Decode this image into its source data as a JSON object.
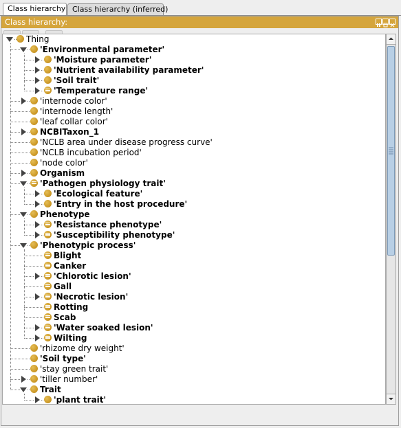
{
  "tabs": [
    {
      "label": "Class hierarchy",
      "active": true
    },
    {
      "label": "Class hierarchy (inferred)",
      "active": false
    }
  ],
  "panel": {
    "title": "Class hierarchy:",
    "header_color": "#d5a53c",
    "header_buttons": [
      "restore-icon",
      "maximize-icon",
      "close-icon"
    ]
  },
  "toolbar": {
    "buttons": [
      {
        "name": "add-subclass-button",
        "icon": "add-subclass-icon"
      },
      {
        "name": "add-sibling-button",
        "icon": "add-sibling-icon"
      },
      {
        "name": "delete-class-button",
        "icon": "delete-class-icon"
      }
    ]
  },
  "tree": {
    "icon_color": "#c99523",
    "nodes": [
      {
        "label": "Thing",
        "depth": 0,
        "toggle": "expanded",
        "bold": false,
        "icon": "class-icon"
      },
      {
        "label": "'Environmental parameter'",
        "depth": 1,
        "toggle": "expanded",
        "bold": true,
        "icon": "class-icon"
      },
      {
        "label": "'Moisture parameter'",
        "depth": 2,
        "toggle": "collapsed",
        "bold": true,
        "icon": "class-icon"
      },
      {
        "label": "'Nutrient availability parameter'",
        "depth": 2,
        "toggle": "collapsed",
        "bold": true,
        "icon": "class-icon"
      },
      {
        "label": "'Soil trait'",
        "depth": 2,
        "toggle": "collapsed",
        "bold": true,
        "icon": "class-icon"
      },
      {
        "label": "'Temperature range'",
        "depth": 2,
        "toggle": "collapsed",
        "bold": true,
        "icon": "defined-class-icon"
      },
      {
        "label": "'internode color'",
        "depth": 1,
        "toggle": "collapsed",
        "bold": false,
        "icon": "class-icon"
      },
      {
        "label": "'internode length'",
        "depth": 1,
        "toggle": "none",
        "bold": false,
        "icon": "class-icon"
      },
      {
        "label": "'leaf collar color'",
        "depth": 1,
        "toggle": "none",
        "bold": false,
        "icon": "class-icon"
      },
      {
        "label": "NCBITaxon_1",
        "depth": 1,
        "toggle": "collapsed",
        "bold": true,
        "icon": "class-icon"
      },
      {
        "label": "'NCLB area under disease progress curve'",
        "depth": 1,
        "toggle": "none",
        "bold": false,
        "icon": "class-icon"
      },
      {
        "label": "'NCLB incubation period'",
        "depth": 1,
        "toggle": "none",
        "bold": false,
        "icon": "class-icon"
      },
      {
        "label": "'node color'",
        "depth": 1,
        "toggle": "none",
        "bold": false,
        "icon": "class-icon"
      },
      {
        "label": "Organism",
        "depth": 1,
        "toggle": "collapsed",
        "bold": true,
        "icon": "class-icon"
      },
      {
        "label": "'Pathogen physiology trait'",
        "depth": 1,
        "toggle": "expanded",
        "bold": true,
        "icon": "defined-class-icon"
      },
      {
        "label": "'Ecological feature'",
        "depth": 2,
        "toggle": "collapsed",
        "bold": true,
        "icon": "class-icon"
      },
      {
        "label": "'Entry in the host procedure'",
        "depth": 2,
        "toggle": "collapsed",
        "bold": true,
        "icon": "class-icon"
      },
      {
        "label": "Phenotype",
        "depth": 1,
        "toggle": "expanded",
        "bold": true,
        "icon": "class-icon"
      },
      {
        "label": "'Resistance phenotype'",
        "depth": 2,
        "toggle": "collapsed",
        "bold": true,
        "icon": "defined-class-icon"
      },
      {
        "label": "'Susceptibility phenotype'",
        "depth": 2,
        "toggle": "collapsed",
        "bold": true,
        "icon": "defined-class-icon"
      },
      {
        "label": "'Phenotypic process'",
        "depth": 1,
        "toggle": "expanded",
        "bold": true,
        "icon": "class-icon"
      },
      {
        "label": "Blight",
        "depth": 2,
        "toggle": "none",
        "bold": true,
        "icon": "defined-class-icon"
      },
      {
        "label": "Canker",
        "depth": 2,
        "toggle": "none",
        "bold": true,
        "icon": "defined-class-icon"
      },
      {
        "label": "'Chlorotic lesion'",
        "depth": 2,
        "toggle": "collapsed",
        "bold": true,
        "icon": "defined-class-icon"
      },
      {
        "label": "Gall",
        "depth": 2,
        "toggle": "none",
        "bold": true,
        "icon": "defined-class-icon"
      },
      {
        "label": "'Necrotic lesion'",
        "depth": 2,
        "toggle": "collapsed",
        "bold": true,
        "icon": "defined-class-icon"
      },
      {
        "label": "Rotting",
        "depth": 2,
        "toggle": "none",
        "bold": true,
        "icon": "defined-class-icon"
      },
      {
        "label": "Scab",
        "depth": 2,
        "toggle": "none",
        "bold": true,
        "icon": "defined-class-icon"
      },
      {
        "label": "'Water soaked lesion'",
        "depth": 2,
        "toggle": "collapsed",
        "bold": true,
        "icon": "defined-class-icon"
      },
      {
        "label": "Wilting",
        "depth": 2,
        "toggle": "collapsed",
        "bold": true,
        "icon": "defined-class-icon"
      },
      {
        "label": "'rhizome dry weight'",
        "depth": 1,
        "toggle": "none",
        "bold": false,
        "icon": "class-icon"
      },
      {
        "label": "'Soil type'",
        "depth": 1,
        "toggle": "none",
        "bold": true,
        "icon": "class-icon"
      },
      {
        "label": "'stay green trait'",
        "depth": 1,
        "toggle": "none",
        "bold": false,
        "icon": "class-icon"
      },
      {
        "label": "'tiller number'",
        "depth": 1,
        "toggle": "collapsed",
        "bold": false,
        "icon": "class-icon"
      },
      {
        "label": "Trait",
        "depth": 1,
        "toggle": "expanded",
        "bold": true,
        "icon": "class-icon"
      },
      {
        "label": "'plant trait'",
        "depth": 2,
        "toggle": "collapsed",
        "bold": true,
        "icon": "class-icon"
      }
    ]
  },
  "scrollbar": {
    "thumb_fraction": 0.57,
    "position_fraction": 0.0
  }
}
